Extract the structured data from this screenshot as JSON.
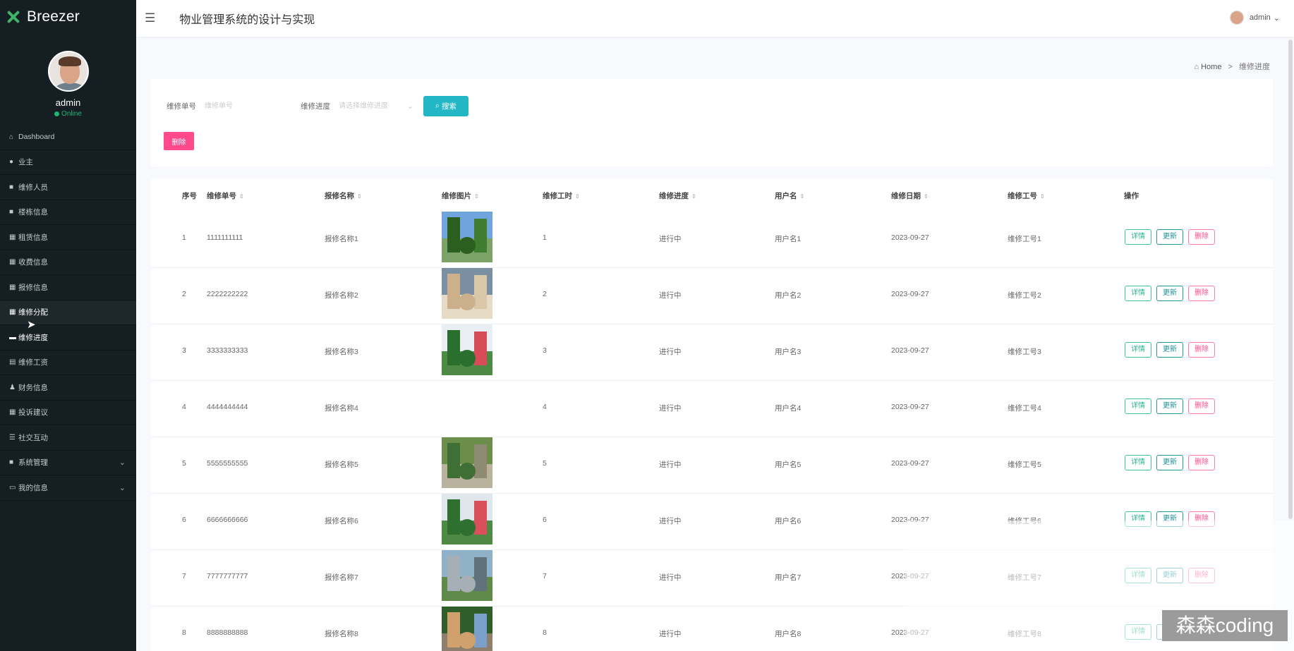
{
  "app": {
    "brand": "Breezer",
    "system_title": "物业管理系统的设计与实现"
  },
  "profile": {
    "name": "admin",
    "status": "Online"
  },
  "sidebar": {
    "items": [
      {
        "label": "Dashboard",
        "icon": "home-icon"
      },
      {
        "label": "业主",
        "icon": "pin-icon"
      },
      {
        "label": "维修人员",
        "icon": "card-icon"
      },
      {
        "label": "楼栋信息",
        "icon": "building-icon"
      },
      {
        "label": "租赁信息",
        "icon": "grid-icon"
      },
      {
        "label": "收费信息",
        "icon": "grid-icon"
      },
      {
        "label": "报修信息",
        "icon": "grid-icon"
      },
      {
        "label": "维修分配",
        "icon": "grid-icon"
      },
      {
        "label": "维修进度",
        "icon": "chat-icon"
      },
      {
        "label": "维修工资",
        "icon": "table-icon"
      },
      {
        "label": "财务信息",
        "icon": "user-icon"
      },
      {
        "label": "投诉建议",
        "icon": "grid-icon"
      },
      {
        "label": "社交互动",
        "icon": "list-icon"
      },
      {
        "label": "系统管理",
        "icon": "gear-icon"
      },
      {
        "label": "我的信息",
        "icon": "id-icon"
      }
    ]
  },
  "header": {
    "user_name": "admin"
  },
  "breadcrumb": {
    "home": "Home",
    "current": "维修进度"
  },
  "search": {
    "order_label": "维修单号",
    "order_placeholder": "维修单号",
    "progress_label": "维修进度",
    "progress_placeholder": "请选择维修进度",
    "search_button": "搜索",
    "delete_button": "删除"
  },
  "table": {
    "headers": [
      "序号",
      "维修单号",
      "报修名称",
      "维修图片",
      "维修工时",
      "维修进度",
      "用户名",
      "维修日期",
      "维修工号",
      "操作"
    ],
    "ops": {
      "detail": "详情",
      "update": "更新",
      "delete": "删除"
    },
    "rows": [
      {
        "index": "1",
        "order_no": "1111111111",
        "name": "报修名称1",
        "hours": "1",
        "progress": "进行中",
        "username": "用户名1",
        "date": "2023-09-27",
        "worker_no": "维修工号1"
      },
      {
        "index": "2",
        "order_no": "2222222222",
        "name": "报修名称2",
        "hours": "2",
        "progress": "进行中",
        "username": "用户名2",
        "date": "2023-09-27",
        "worker_no": "维修工号2"
      },
      {
        "index": "3",
        "order_no": "3333333333",
        "name": "报修名称3",
        "hours": "3",
        "progress": "进行中",
        "username": "用户名3",
        "date": "2023-09-27",
        "worker_no": "维修工号3"
      },
      {
        "index": "4",
        "order_no": "4444444444",
        "name": "报修名称4",
        "hours": "4",
        "progress": "进行中",
        "username": "用户名4",
        "date": "2023-09-27",
        "worker_no": "维修工号4"
      },
      {
        "index": "5",
        "order_no": "5555555555",
        "name": "报修名称5",
        "hours": "5",
        "progress": "进行中",
        "username": "用户名5",
        "date": "2023-09-27",
        "worker_no": "维修工号5"
      },
      {
        "index": "6",
        "order_no": "6666666666",
        "name": "报修名称6",
        "hours": "6",
        "progress": "进行中",
        "username": "用户名6",
        "date": "2023-09-27",
        "worker_no": "维修工号6"
      },
      {
        "index": "7",
        "order_no": "7777777777",
        "name": "报修名称7",
        "hours": "7",
        "progress": "进行中",
        "username": "用户名7",
        "date": "2023-09-27",
        "worker_no": "维修工号7"
      },
      {
        "index": "8",
        "order_no": "8888888888",
        "name": "报修名称8",
        "hours": "8",
        "progress": "进行中",
        "username": "用户名8",
        "date": "2023-09-27",
        "worker_no": "维修工号8"
      }
    ]
  },
  "watermark": "森森coding",
  "colors": {
    "sidebar": "#151e22",
    "brand_green": "#3fb56a",
    "search_button": "#23b7c6",
    "delete_button": "#fe4a8b"
  }
}
